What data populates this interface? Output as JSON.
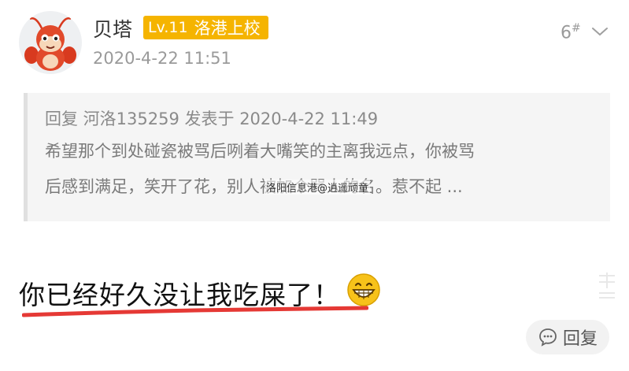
{
  "post": {
    "username": "贝塔",
    "level": "Lv.11",
    "rank": "洛港上校",
    "date": "2020-4-22 11:51",
    "floor": "6",
    "floor_mark": "#"
  },
  "quote": {
    "header": "回复 河洛135259 发表于 2020-4-22 11:49",
    "line1": "希望那个到处碰瓷被骂后咧着大嘴笑的主离我远点，你被骂",
    "line2": "后感到满足，笑开了花，别人被加个骂人的名。惹不起 ..."
  },
  "watermark": "洛阳信息港@逍遥顽童",
  "content": {
    "text": "你已经好久没让我吃屎了！",
    "emoji": "grinning-face-icon"
  },
  "actions": {
    "reply_label": "回复"
  },
  "colors": {
    "badge": "#f5b400",
    "underline": "#e53935"
  }
}
